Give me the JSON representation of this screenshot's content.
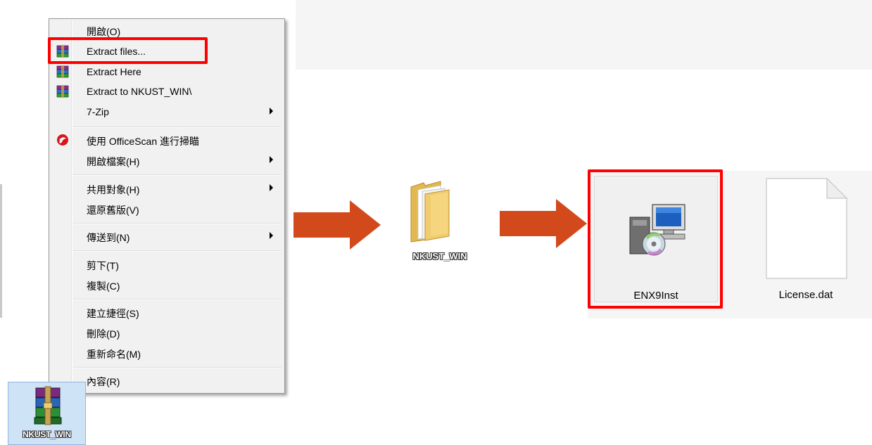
{
  "context_menu": {
    "items": [
      {
        "label": "開啟(O)"
      },
      {
        "label": "Extract files...",
        "icon": "winrar-icon"
      },
      {
        "label": "Extract Here",
        "icon": "winrar-icon"
      },
      {
        "label": "Extract to NKUST_WIN\\",
        "icon": "winrar-icon"
      },
      {
        "label": "7-Zip",
        "submenu": true
      },
      {
        "label": "使用 OfficeScan 進行掃瞄",
        "icon": "officescan-icon"
      },
      {
        "label": "開啟檔案(H)",
        "submenu": true
      },
      {
        "label": "共用對象(H)",
        "submenu": true
      },
      {
        "label": "還原舊版(V)"
      },
      {
        "label": "傳送到(N)",
        "submenu": true
      },
      {
        "label": "剪下(T)"
      },
      {
        "label": "複製(C)"
      },
      {
        "label": "建立捷徑(S)"
      },
      {
        "label": "刪除(D)"
      },
      {
        "label": "重新命名(M)"
      },
      {
        "label": "內容(R)"
      }
    ]
  },
  "desktop_file": {
    "label": "NKUST_WIN",
    "icon": "winrar-archive-icon"
  },
  "extracted_folder": {
    "label": "NKUST_WIN",
    "icon": "folder-icon"
  },
  "explorer_files": [
    {
      "label": "ENX9Inst",
      "icon": "installer-icon",
      "highlighted": true
    },
    {
      "label": "License.dat",
      "icon": "blank-file-icon"
    }
  ],
  "colors": {
    "highlight": "#ff0000",
    "arrow": "#d2491c"
  }
}
